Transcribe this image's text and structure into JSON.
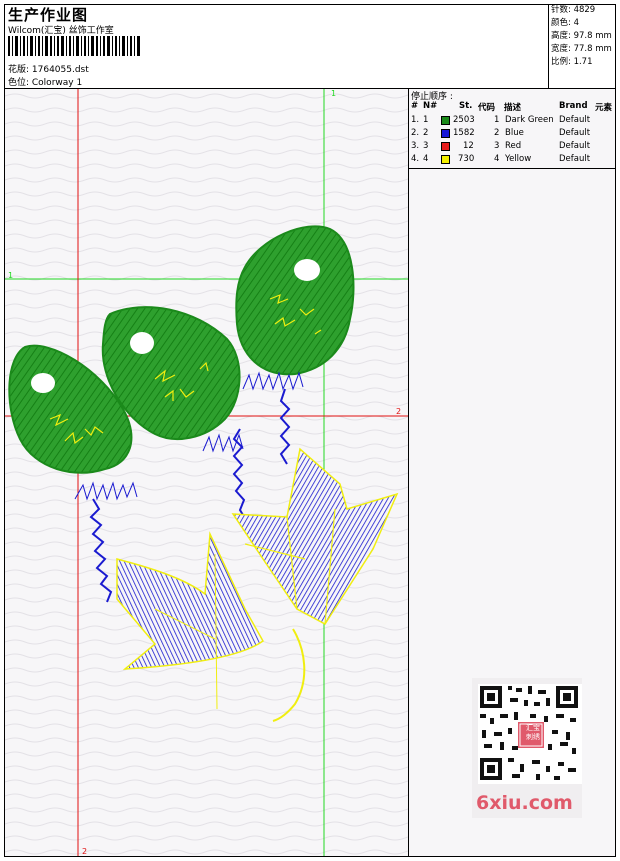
{
  "header": {
    "title": "生产作业图",
    "company": "Wilcom(汇宝) 丝饰工作室",
    "design_label": "花版: 1764055.dst",
    "colorway_label": "色位: Colorway 1"
  },
  "stats": {
    "stitches": "针数: 4829",
    "colors": "颜色: 4",
    "height": "高度: 97.8 mm",
    "width": "宽度: 77.8 mm",
    "ratio": "比例: 1.71"
  },
  "stop_sequence": {
    "title": "停止顺序 :",
    "headers": {
      "num": "#",
      "no": "N#",
      "st": "St.",
      "code": "代码",
      "desc": "描述",
      "brand": "Brand",
      "elem": "元素"
    },
    "rows": [
      {
        "num": "1.",
        "no": "1",
        "color": "#1a8a1a",
        "st": "2503",
        "code": "1",
        "desc": "Dark Green",
        "brand": "Default"
      },
      {
        "num": "2.",
        "no": "2",
        "color": "#1515d8",
        "st": "1582",
        "code": "2",
        "desc": "Blue",
        "brand": "Default"
      },
      {
        "num": "3.",
        "no": "3",
        "color": "#e51c1c",
        "st": "12",
        "code": "3",
        "desc": "Red",
        "brand": "Default"
      },
      {
        "num": "4.",
        "no": "4",
        "color": "#f4f000",
        "st": "730",
        "code": "4",
        "desc": "Yellow",
        "brand": "Default"
      }
    ]
  },
  "guides": {
    "green_v_label": "1",
    "green_h_label": "1",
    "red_h_label": "2",
    "red_v_label": "2"
  },
  "watermark": {
    "site": "6xiu.com",
    "seal": "汇宝 刺绣"
  },
  "colors": {
    "green": "#1f9a1f",
    "blue": "#1a1ad0",
    "red": "#e02020",
    "yellow": "#f0ee10",
    "guide_green": "#22d822",
    "guide_red": "#e01010"
  }
}
